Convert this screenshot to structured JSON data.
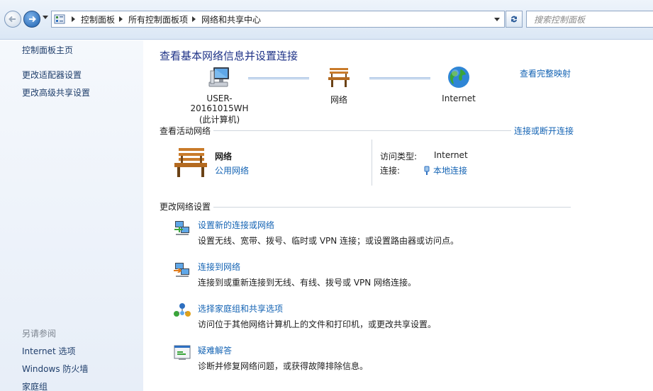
{
  "address": {
    "crumbs": [
      "控制面板",
      "所有控制面板项",
      "网络和共享中心"
    ],
    "search_placeholder": "搜索控制面板"
  },
  "sidebar": {
    "items": [
      "控制面板主页",
      "更改适配器设置",
      "更改高级共享设置"
    ],
    "see_also_heading": "另请参阅",
    "see_also": [
      "Internet 选项",
      "Windows 防火墙",
      "家庭组"
    ]
  },
  "main": {
    "title": "查看基本网络信息并设置连接",
    "full_map_link": "查看完整映射",
    "map": {
      "computer_name": "USER-20161015WH",
      "computer_sub": "(此计算机)",
      "network": "网络",
      "internet": "Internet"
    },
    "active_section_label": "查看活动网络",
    "connect_link": "连接或断开连接",
    "active_network": {
      "name": "网络",
      "type": "公用网络",
      "access_label": "访问类型:",
      "access_value": "Internet",
      "connection_label": "连接:",
      "connection_value": "本地连接"
    },
    "change_section_label": "更改网络设置",
    "tasks": [
      {
        "icon": "network-setup-icon",
        "title": "设置新的连接或网络",
        "desc": "设置无线、宽带、拨号、临时或 VPN 连接；或设置路由器或访问点。"
      },
      {
        "icon": "connect-network-icon",
        "title": "连接到网络",
        "desc": "连接到或重新连接到无线、有线、拨号或 VPN 网络连接。"
      },
      {
        "icon": "homegroup-icon",
        "title": "选择家庭组和共享选项",
        "desc": "访问位于其他网络计算机上的文件和打印机，或更改共享设置。"
      },
      {
        "icon": "troubleshoot-icon",
        "title": "疑难解答",
        "desc": "诊断并修复网络问题，或获得故障排除信息。"
      }
    ]
  },
  "colors": {
    "link": "#1564b4",
    "title": "#1e3287",
    "sidebar_link": "#1f3e6b",
    "muted": "#7d8590"
  }
}
